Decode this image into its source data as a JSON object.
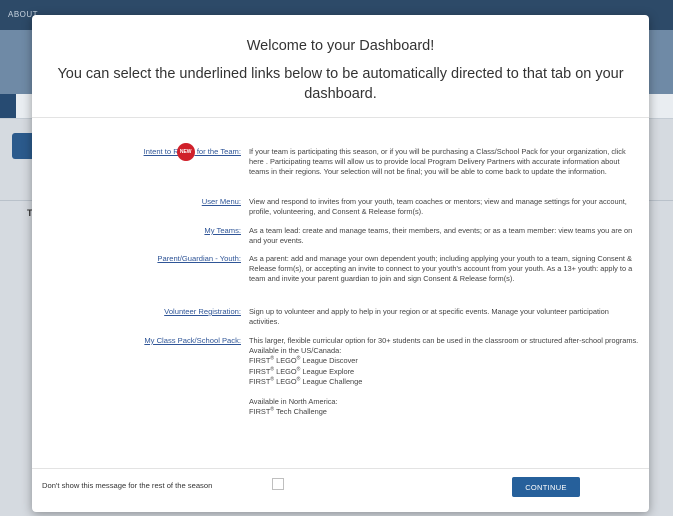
{
  "background": {
    "about_label": "ABOUT",
    "table_letter": "T"
  },
  "modal": {
    "title": "Welcome to your Dashboard!",
    "subtitle": "You can select the underlined links below to be automatically directed to that tab on your dashboard.",
    "items": [
      {
        "link_prefix": "Intent to R",
        "badge": "NEW",
        "link_suffix": " for the Team:",
        "description": "If your team is participating this season, or if you will be purchasing a Class/School Pack for your organization, click here . Participating teams will allow us to provide local Program Delivery Partners with accurate information about teams in their regions. Your selection will not be final; you will be able to come back to update the information."
      },
      {
        "link": "User Menu:",
        "description": "View and respond to invites from your youth, team coaches or mentors; view and manage settings for your account, profile, volunteering, and Consent & Release form(s)."
      },
      {
        "link": "My Teams:",
        "description": "As a team lead: create and manage teams, their members, and events; or as a team member: view teams you are on and your events."
      },
      {
        "link": "Parent/Guardian - Youth:",
        "description": "As a parent: add and manage your own dependent youth; including applying your youth to a team, signing Consent & Release form(s), or accepting an invite to connect to your youth's account from your youth. As a 13+ youth: apply to a team and invite your parent guardian to join and sign Consent & Release form(s)."
      },
      {
        "link": "Volunteer Registration:",
        "description": "Sign up to volunteer and apply to help in your region or at specific events. Manage your volunteer participation activities."
      },
      {
        "link": "My Class Pack/School Pack:",
        "description": "This larger, flexible curricular option for 30+ students can be used in the classroom or structured after-school programs.",
        "available_us": "Available in the US/Canada:",
        "brand": "FIRST",
        "reg": "®",
        "programs_us": [
          " LEGO",
          " LEGO",
          " LEGO"
        ],
        "program_names_us": [
          " League Discover",
          " League Explore",
          " League Challenge"
        ],
        "available_na": "Available in North America:",
        "program_na": " Tech Challenge"
      }
    ],
    "footer": {
      "dont_show_label": "Don't show this message for the rest of the season",
      "continue_label": "CONTINUE"
    }
  }
}
